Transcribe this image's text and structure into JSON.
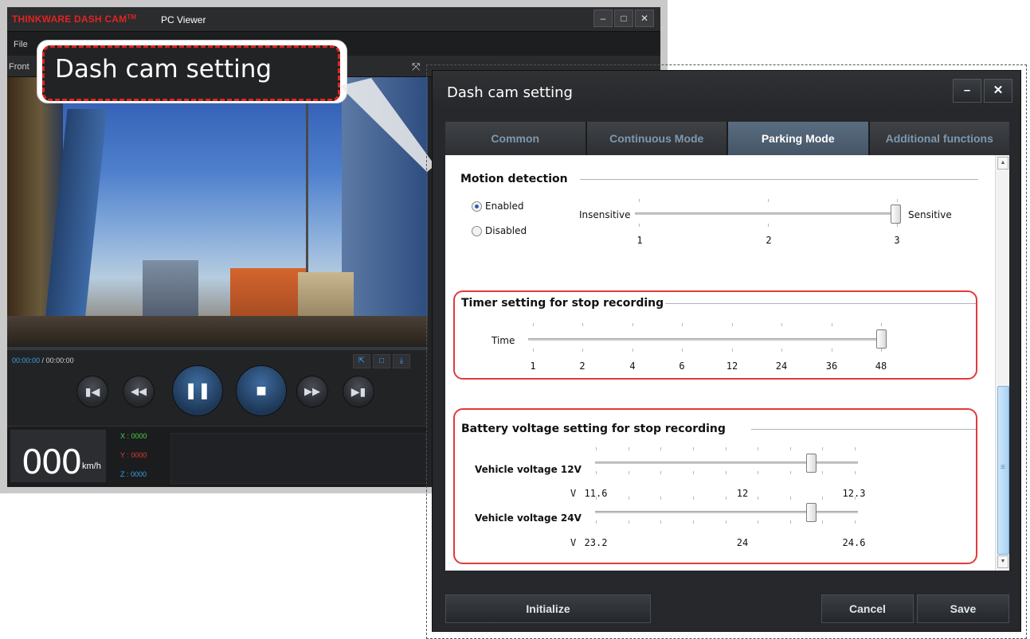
{
  "viewer": {
    "brand": "THINKWARE DASH CAM",
    "brand_tm": "TM",
    "app_name": "PC Viewer",
    "window_buttons": [
      "–",
      "□",
      "✕"
    ],
    "menu_file": "File",
    "tab_front": "Front",
    "time_current": "00:00:00",
    "time_sep": " / ",
    "time_total": "00:00:00",
    "progress": 0,
    "speed": "000",
    "speed_unit": "km/h",
    "axis_x": "X : 0000",
    "axis_y": "Y : 0000",
    "axis_z": "Z : 0000"
  },
  "callout": {
    "text": "Dash cam setting"
  },
  "dialog": {
    "title": "Dash cam setting",
    "minimize": "–",
    "close": "✕",
    "tabs": [
      "Common",
      "Continuous Mode",
      "Parking Mode",
      "Additional functions"
    ],
    "active_tab": 2,
    "motion": {
      "title": "Motion detection",
      "enabled_label": "Enabled",
      "disabled_label": "Disabled",
      "selected": "Enabled",
      "left_label": "Insensitive",
      "right_label": "Sensitive",
      "ticks": [
        "1",
        "2",
        "3"
      ],
      "value": "3"
    },
    "timer": {
      "title": "Timer setting for stop recording",
      "time_label": "Time",
      "ticks": [
        "1",
        "2",
        "4",
        "6",
        "12",
        "24",
        "36",
        "48"
      ],
      "value": "48"
    },
    "battery": {
      "title": "Battery voltage setting for stop recording",
      "v12_label": "Vehicle voltage 12V",
      "v12_ticks": [
        "11.6",
        "12",
        "12.3"
      ],
      "v12_prefix": "V",
      "v12_level": 0.83,
      "v24_label": "Vehicle voltage 24V",
      "v24_ticks": [
        "23.2",
        "24",
        "24.6"
      ],
      "v24_prefix": "V",
      "v24_level": 0.83
    },
    "buttons": {
      "initialize": "Initialize",
      "cancel": "Cancel",
      "save": "Save"
    }
  },
  "colors": {
    "brand_red": "#e1241f",
    "highlight_red": "#e03a3a",
    "accent_blue": "#3aa1e6"
  },
  "icons": [
    "skip-back-icon",
    "rewind-icon",
    "pause-icon",
    "stop-icon",
    "fast-forward-icon",
    "skip-forward-icon",
    "scrollbar-up-arrow-icon",
    "scrollbar-down-arrow-icon"
  ]
}
